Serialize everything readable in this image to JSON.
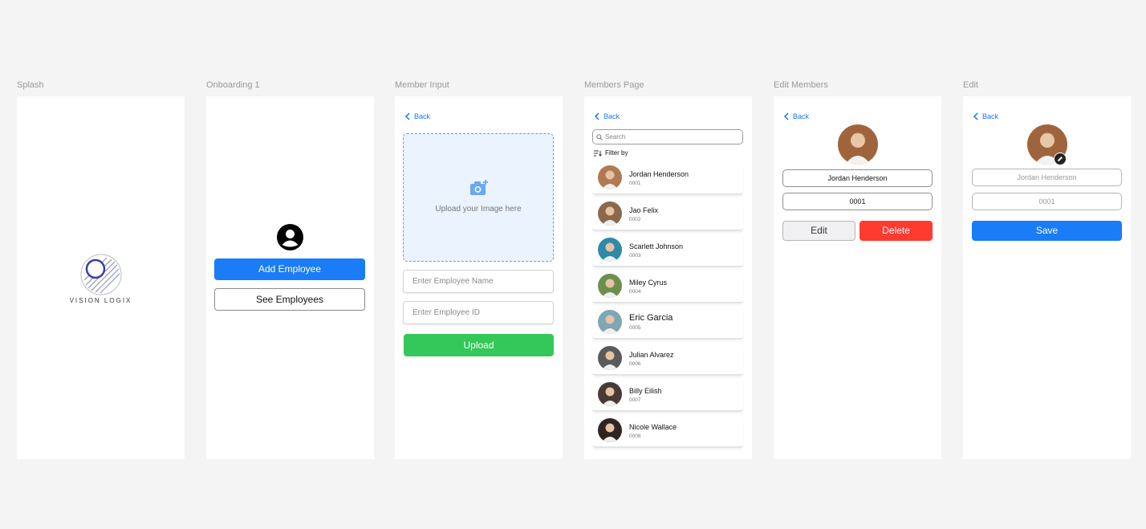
{
  "frames": {
    "splash": "Splash",
    "onboarding": "Onboarding 1",
    "member_input": "Member Input",
    "members_page": "Members Page",
    "edit_members": "Edit Members",
    "edit": "Edit"
  },
  "splash": {
    "logo_text": "VISION LOGIX"
  },
  "onboarding": {
    "add_label": "Add Employee",
    "see_label": "See Employees",
    "icon": "user-circle-icon"
  },
  "common": {
    "back_label": "Back"
  },
  "member_input": {
    "upload_text": "Upload your Image here",
    "name_placeholder": "Enter Employee Name",
    "id_placeholder": "Enter Employee ID",
    "upload_button": "Upload"
  },
  "members_page": {
    "search_placeholder": "Search",
    "filter_label": "Filter by",
    "members": [
      {
        "name": "Jordan Henderson",
        "id": "0001",
        "color": "#b07a52"
      },
      {
        "name": "Jao Felix",
        "id": "0002",
        "color": "#8a6a4c"
      },
      {
        "name": "Scarlett Johnson",
        "id": "0003",
        "color": "#2f8aa8"
      },
      {
        "name": "Miley Cyrus",
        "id": "0004",
        "color": "#6d8f4d"
      },
      {
        "name": "Eric Garcia",
        "id": "0005",
        "color": "#7fa6b5"
      },
      {
        "name": "Julian Alvarez",
        "id": "0006",
        "color": "#5a5a5a"
      },
      {
        "name": "Billy Eilish",
        "id": "0007",
        "color": "#4a3a36"
      },
      {
        "name": "Nicole Wallace",
        "id": "0008",
        "color": "#2e2523"
      }
    ]
  },
  "edit_members": {
    "name": "Jordan Henderson",
    "id": "0001",
    "edit_label": "Edit",
    "delete_label": "Delete"
  },
  "edit": {
    "name_placeholder": "Jordan Henderson",
    "id_placeholder": "0001",
    "save_label": "Save"
  },
  "colors": {
    "primary": "#1a7cf7",
    "success": "#34c759",
    "danger": "#ff3b30",
    "background": "#f4f4f4"
  }
}
